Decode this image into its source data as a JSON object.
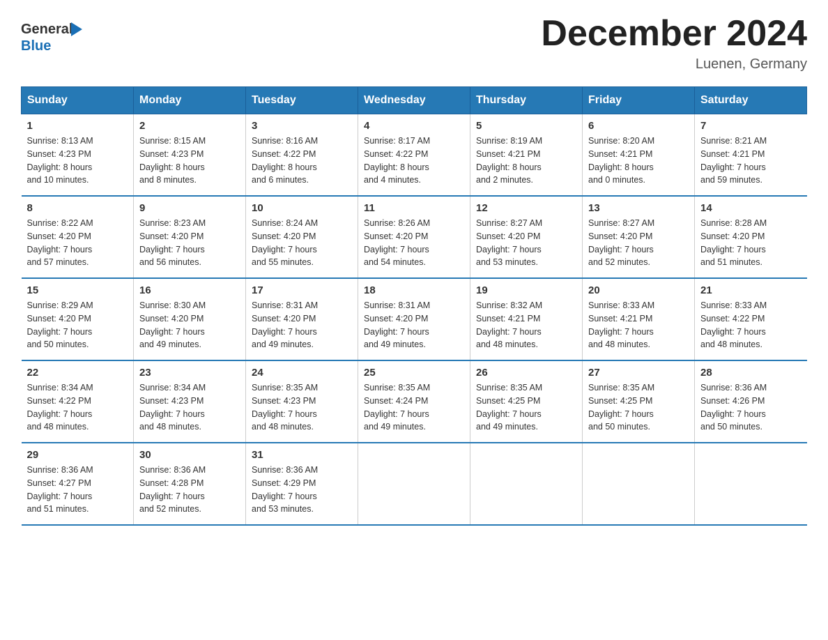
{
  "header": {
    "logo_text_general": "General",
    "logo_text_blue": "Blue",
    "month_title": "December 2024",
    "location": "Luenen, Germany"
  },
  "weekdays": [
    "Sunday",
    "Monday",
    "Tuesday",
    "Wednesday",
    "Thursday",
    "Friday",
    "Saturday"
  ],
  "weeks": [
    [
      {
        "day": "1",
        "info": "Sunrise: 8:13 AM\nSunset: 4:23 PM\nDaylight: 8 hours\nand 10 minutes."
      },
      {
        "day": "2",
        "info": "Sunrise: 8:15 AM\nSunset: 4:23 PM\nDaylight: 8 hours\nand 8 minutes."
      },
      {
        "day": "3",
        "info": "Sunrise: 8:16 AM\nSunset: 4:22 PM\nDaylight: 8 hours\nand 6 minutes."
      },
      {
        "day": "4",
        "info": "Sunrise: 8:17 AM\nSunset: 4:22 PM\nDaylight: 8 hours\nand 4 minutes."
      },
      {
        "day": "5",
        "info": "Sunrise: 8:19 AM\nSunset: 4:21 PM\nDaylight: 8 hours\nand 2 minutes."
      },
      {
        "day": "6",
        "info": "Sunrise: 8:20 AM\nSunset: 4:21 PM\nDaylight: 8 hours\nand 0 minutes."
      },
      {
        "day": "7",
        "info": "Sunrise: 8:21 AM\nSunset: 4:21 PM\nDaylight: 7 hours\nand 59 minutes."
      }
    ],
    [
      {
        "day": "8",
        "info": "Sunrise: 8:22 AM\nSunset: 4:20 PM\nDaylight: 7 hours\nand 57 minutes."
      },
      {
        "day": "9",
        "info": "Sunrise: 8:23 AM\nSunset: 4:20 PM\nDaylight: 7 hours\nand 56 minutes."
      },
      {
        "day": "10",
        "info": "Sunrise: 8:24 AM\nSunset: 4:20 PM\nDaylight: 7 hours\nand 55 minutes."
      },
      {
        "day": "11",
        "info": "Sunrise: 8:26 AM\nSunset: 4:20 PM\nDaylight: 7 hours\nand 54 minutes."
      },
      {
        "day": "12",
        "info": "Sunrise: 8:27 AM\nSunset: 4:20 PM\nDaylight: 7 hours\nand 53 minutes."
      },
      {
        "day": "13",
        "info": "Sunrise: 8:27 AM\nSunset: 4:20 PM\nDaylight: 7 hours\nand 52 minutes."
      },
      {
        "day": "14",
        "info": "Sunrise: 8:28 AM\nSunset: 4:20 PM\nDaylight: 7 hours\nand 51 minutes."
      }
    ],
    [
      {
        "day": "15",
        "info": "Sunrise: 8:29 AM\nSunset: 4:20 PM\nDaylight: 7 hours\nand 50 minutes."
      },
      {
        "day": "16",
        "info": "Sunrise: 8:30 AM\nSunset: 4:20 PM\nDaylight: 7 hours\nand 49 minutes."
      },
      {
        "day": "17",
        "info": "Sunrise: 8:31 AM\nSunset: 4:20 PM\nDaylight: 7 hours\nand 49 minutes."
      },
      {
        "day": "18",
        "info": "Sunrise: 8:31 AM\nSunset: 4:20 PM\nDaylight: 7 hours\nand 49 minutes."
      },
      {
        "day": "19",
        "info": "Sunrise: 8:32 AM\nSunset: 4:21 PM\nDaylight: 7 hours\nand 48 minutes."
      },
      {
        "day": "20",
        "info": "Sunrise: 8:33 AM\nSunset: 4:21 PM\nDaylight: 7 hours\nand 48 minutes."
      },
      {
        "day": "21",
        "info": "Sunrise: 8:33 AM\nSunset: 4:22 PM\nDaylight: 7 hours\nand 48 minutes."
      }
    ],
    [
      {
        "day": "22",
        "info": "Sunrise: 8:34 AM\nSunset: 4:22 PM\nDaylight: 7 hours\nand 48 minutes."
      },
      {
        "day": "23",
        "info": "Sunrise: 8:34 AM\nSunset: 4:23 PM\nDaylight: 7 hours\nand 48 minutes."
      },
      {
        "day": "24",
        "info": "Sunrise: 8:35 AM\nSunset: 4:23 PM\nDaylight: 7 hours\nand 48 minutes."
      },
      {
        "day": "25",
        "info": "Sunrise: 8:35 AM\nSunset: 4:24 PM\nDaylight: 7 hours\nand 49 minutes."
      },
      {
        "day": "26",
        "info": "Sunrise: 8:35 AM\nSunset: 4:25 PM\nDaylight: 7 hours\nand 49 minutes."
      },
      {
        "day": "27",
        "info": "Sunrise: 8:35 AM\nSunset: 4:25 PM\nDaylight: 7 hours\nand 50 minutes."
      },
      {
        "day": "28",
        "info": "Sunrise: 8:36 AM\nSunset: 4:26 PM\nDaylight: 7 hours\nand 50 minutes."
      }
    ],
    [
      {
        "day": "29",
        "info": "Sunrise: 8:36 AM\nSunset: 4:27 PM\nDaylight: 7 hours\nand 51 minutes."
      },
      {
        "day": "30",
        "info": "Sunrise: 8:36 AM\nSunset: 4:28 PM\nDaylight: 7 hours\nand 52 minutes."
      },
      {
        "day": "31",
        "info": "Sunrise: 8:36 AM\nSunset: 4:29 PM\nDaylight: 7 hours\nand 53 minutes."
      },
      {
        "day": "",
        "info": ""
      },
      {
        "day": "",
        "info": ""
      },
      {
        "day": "",
        "info": ""
      },
      {
        "day": "",
        "info": ""
      }
    ]
  ]
}
